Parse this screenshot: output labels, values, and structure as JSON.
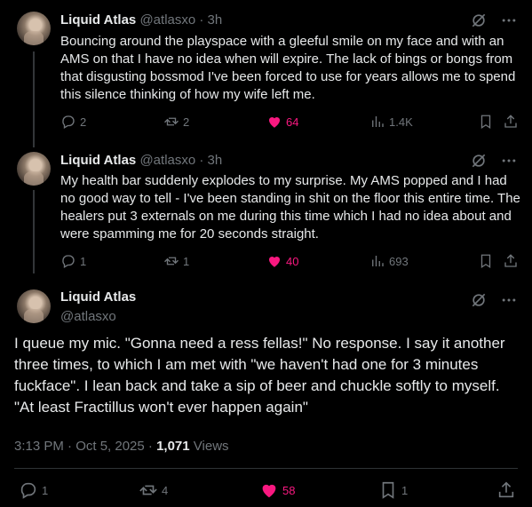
{
  "tweets": [
    {
      "name": "Liquid Atlas",
      "handle": "@atlasxo",
      "time": "· 3h",
      "text": "Bouncing around the playspace with a gleeful smile on my face and with an AMS on that I have no idea when will expire. The lack of bings or bongs from that disgusting bossmod I've been forced to use for years allows me to spend this silence thinking of how my wife left me.",
      "replies": "2",
      "reposts": "2",
      "likes": "64",
      "views": "1.4K"
    },
    {
      "name": "Liquid Atlas",
      "handle": "@atlasxo",
      "time": "· 3h",
      "text": "My health bar suddenly explodes to my surprise. My AMS popped and I had no good way to tell - I've been standing in shit on the floor this entire time. The healers put 3 externals on me during this time which I had no idea about and were spamming me for 20 seconds straight.",
      "replies": "1",
      "reposts": "1",
      "likes": "40",
      "views": "693"
    }
  ],
  "focus": {
    "name": "Liquid Atlas",
    "handle": "@atlasxo",
    "text": "I queue my mic. \"Gonna need a ress fellas!\" No response. I say it another three times, to which I am met with \"we haven't had one for 3 minutes fuckface\". I lean back and take a sip of beer and chuckle softly to myself. \"At least Fractillus won't ever happen again\"",
    "time_date": "3:13 PM · Oct 5, 2025 · ",
    "views_count": "1,071",
    "views_label": " Views",
    "replies": "1",
    "reposts": "4",
    "likes": "58",
    "bookmarks": "1"
  },
  "colors": {
    "like": "#f91880",
    "muted": "#71767b",
    "text": "#e7e9ea"
  },
  "icons": [
    "reply-icon",
    "repost-icon",
    "heart-icon",
    "views-icon",
    "bookmark-icon",
    "share-icon",
    "grok-icon",
    "more-icon"
  ]
}
